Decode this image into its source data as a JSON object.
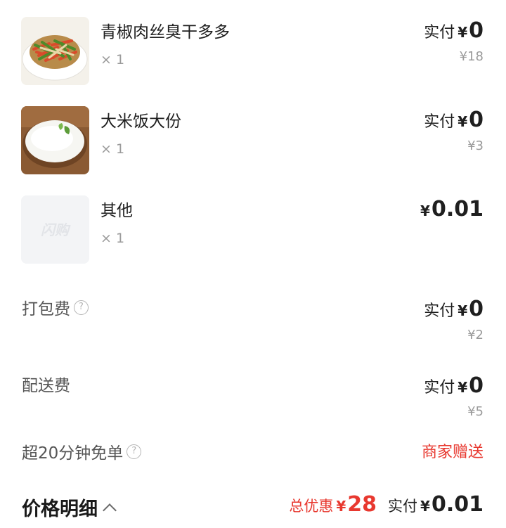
{
  "items": [
    {
      "name": "青椒肉丝臭干多多",
      "qty": "× 1",
      "pay_label": "实付",
      "yen": "¥",
      "pay_amount": "0",
      "original": "¥18",
      "image": "stir-fry-dish-photo"
    },
    {
      "name": "大米饭大份",
      "qty": "× 1",
      "pay_label": "实付",
      "yen": "¥",
      "pay_amount": "0",
      "original": "¥3",
      "image": "rice-bowl-photo"
    },
    {
      "name": "其他",
      "qty": "× 1",
      "yen": "¥",
      "pay_amount": "0.01",
      "image": "placeholder-logo",
      "placeholder_text": "闪购"
    }
  ],
  "fees": [
    {
      "label": "打包费",
      "help_icon": "question-circle-icon",
      "pay_label": "实付",
      "yen": "¥",
      "pay_amount": "0",
      "original": "¥2"
    },
    {
      "label": "配送费",
      "pay_label": "实付",
      "yen": "¥",
      "pay_amount": "0",
      "original": "¥5"
    }
  ],
  "free_order": {
    "label": "超20分钟免单",
    "help_icon": "question-circle-icon",
    "value": "商家赠送"
  },
  "summary": {
    "title": "价格明细",
    "discount_label": "总优惠",
    "discount_yen": "¥",
    "discount_amount": "28",
    "total_label": "实付",
    "total_yen": "¥",
    "total_amount": "0.01"
  },
  "colors": {
    "accent_red": "#e8382f",
    "text": "#1f1f1f",
    "muted": "#9a9a9a"
  }
}
